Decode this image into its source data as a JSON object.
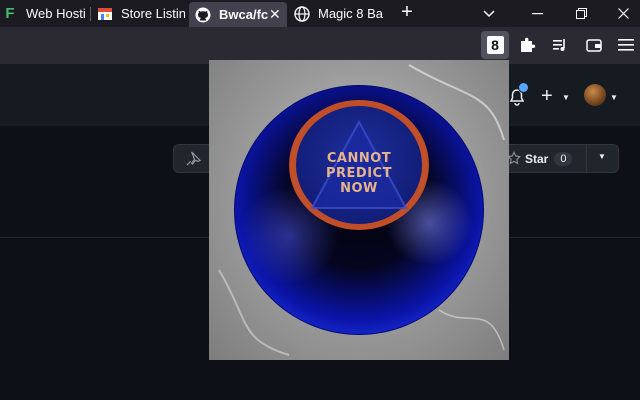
{
  "browser": {
    "tabs": [
      {
        "label": "Web Hostin",
        "icon": "letter-f-icon",
        "icon_text": "F"
      },
      {
        "label": "Store Listin",
        "icon": "store-icon"
      },
      {
        "label": "Bwca/fc",
        "icon": "github-icon",
        "active": true
      },
      {
        "label": "Magic 8 Ba",
        "icon": "globe-icon"
      }
    ],
    "new_tab_label": "+",
    "extension_badge": "8"
  },
  "repo": {
    "star_label": "Star",
    "star_count": "0"
  },
  "magic8ball": {
    "answer_lines": [
      "CANNOT",
      "PREDICT",
      "NOW"
    ]
  },
  "colors": {
    "ball_blue": "#1f35e6",
    "answer_text": "#e7b48a",
    "notification_dot": "#58a6ff"
  }
}
